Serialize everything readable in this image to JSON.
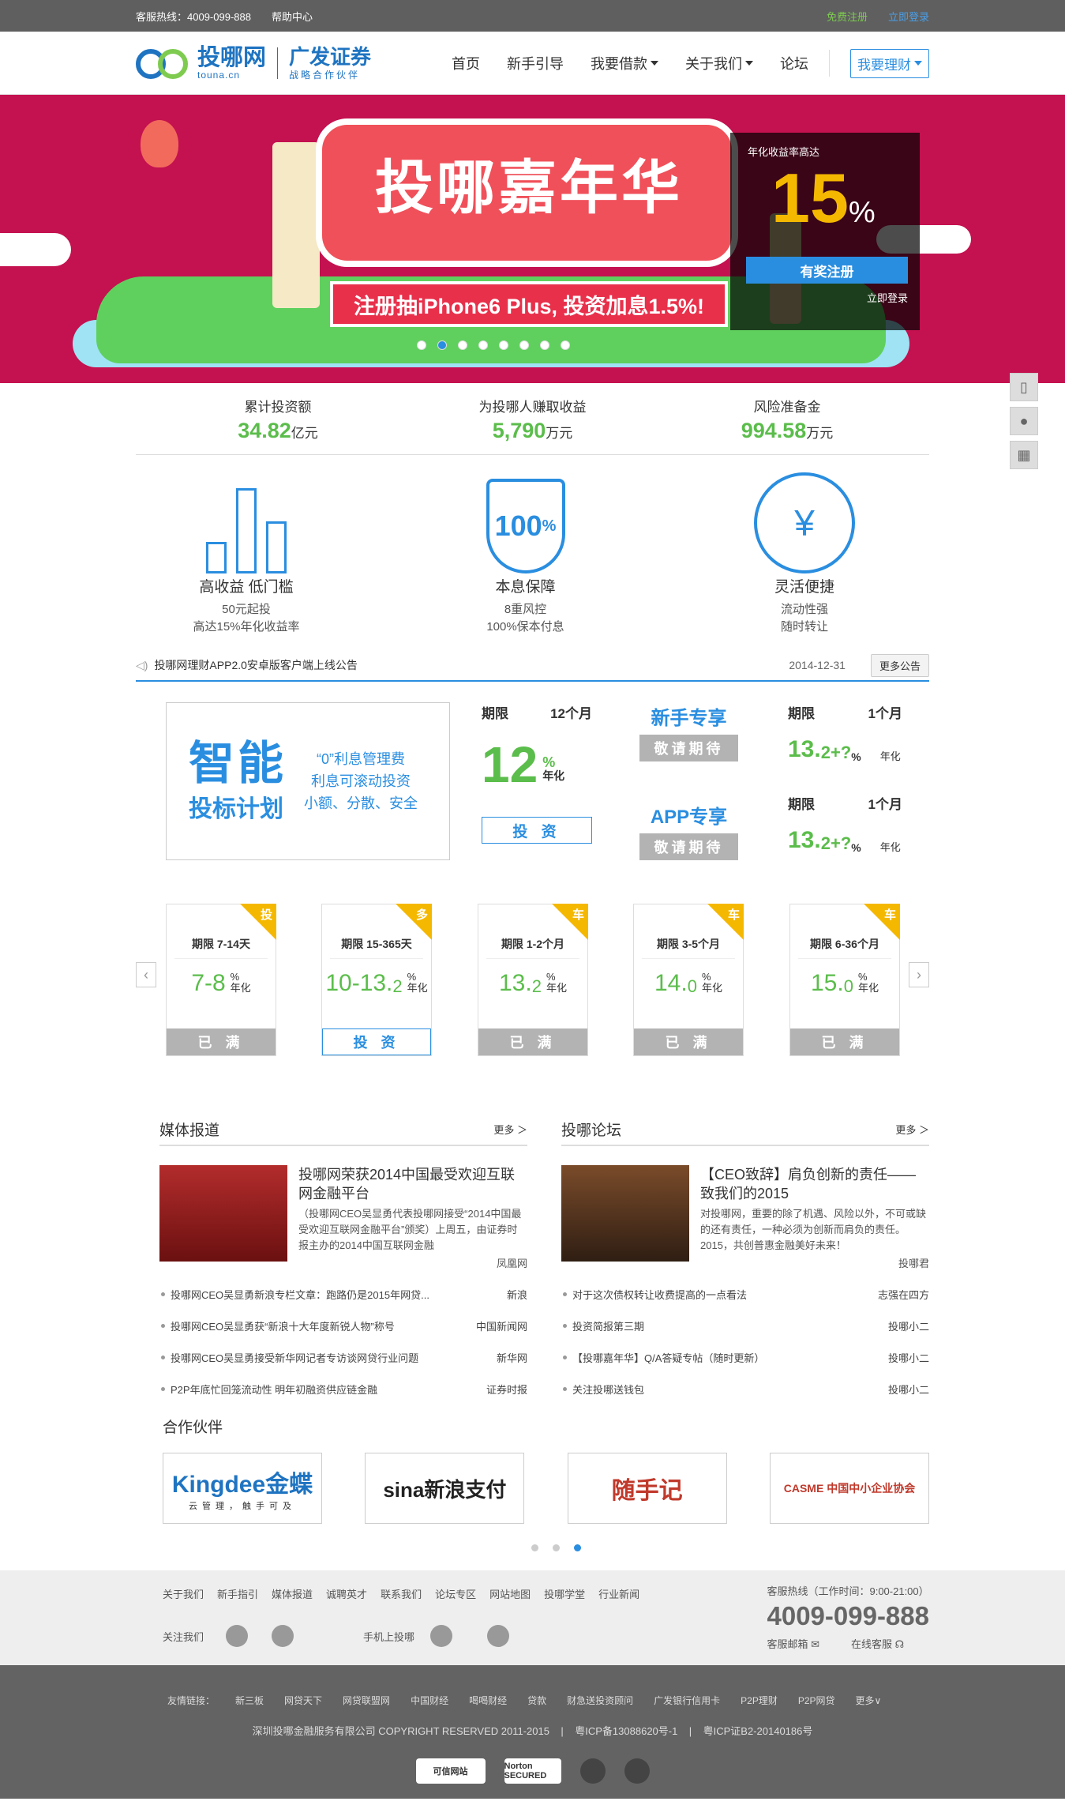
{
  "topbar": {
    "hotline": "客服热线：4009-099-888",
    "help": "帮助中心",
    "register": "免费注册",
    "login": "立即登录"
  },
  "logo": {
    "name": "投哪网",
    "domain": "touna.cn",
    "partner": "广发证券",
    "partner_sub": "战略合作伙伴"
  },
  "nav": {
    "home": "首页",
    "guide": "新手引导",
    "borrow": "我要借款",
    "about": "关于我们",
    "forum": "论坛",
    "invest": "我要理财"
  },
  "banner": {
    "title": "投哪嘉年华",
    "ribbon": "注册抽iPhone6 Plus, 投资加息1.5%!",
    "rate_label": "年化收益率高达",
    "rate": "15",
    "rate_unit": "%",
    "button": "有奖注册",
    "login": "立即登录",
    "active_slide": 1
  },
  "stats": [
    {
      "label": "累计投资额",
      "value": "34.82",
      "unit": "亿元"
    },
    {
      "label": "为投哪人赚取收益",
      "value": "5,790",
      "unit": "万元"
    },
    {
      "label": "风险准备金",
      "value": "994.58",
      "unit": "万元"
    }
  ],
  "features": [
    {
      "title": "高收益 低门槛",
      "line1": "50元起投",
      "line2": "高达15%年化收益率"
    },
    {
      "title": "本息保障",
      "line1": "8重风控",
      "line2": "100%保本付息",
      "badge": "100",
      "badge_unit": "%"
    },
    {
      "title": "灵活便捷",
      "line1": "流动性强",
      "line2": "随时转让",
      "symbol": "¥"
    }
  ],
  "notice": {
    "text": "投哪网理财APP2.0安卓版客户端上线公告",
    "date": "2014-12-31",
    "more": "更多公告"
  },
  "smart": {
    "big1": "智能",
    "big2": "投标计划",
    "r1": "“0”利息管理费",
    "r2": "利息可滚动投资",
    "r3": "小额、分散、安全"
  },
  "plan_main": {
    "term_label": "期限",
    "term": "12个月",
    "rate": "12",
    "unit": "%",
    "year": "年化",
    "button": "投 资"
  },
  "plan_new": {
    "title": "新手专享",
    "button": "敬请期待",
    "term_label": "期限",
    "term": "1个月",
    "rate": "13.",
    "rate_sm": "2+?",
    "unit": "%",
    "year": "年化"
  },
  "plan_app": {
    "title": "APP专享",
    "button": "敬请期待",
    "term_label": "期限",
    "term": "1个月",
    "rate": "13.",
    "rate_sm": "2+?",
    "unit": "%",
    "year": "年化"
  },
  "cards": [
    {
      "tag": "投",
      "term": "期限 7-14天",
      "rate": "7-8",
      "button": "已 满",
      "state": "full"
    },
    {
      "tag": "多",
      "term": "期限 15-365天",
      "rate": "10-13.",
      "rate_sm": "2",
      "button": "投 资",
      "state": "invest"
    },
    {
      "tag": "车",
      "term": "期限 1-2个月",
      "rate": "13.",
      "rate_sm": "2",
      "button": "已 满",
      "state": "full"
    },
    {
      "tag": "车",
      "term": "期限 3-5个月",
      "rate": "14.",
      "rate_sm": "0",
      "button": "已 满",
      "state": "full"
    },
    {
      "tag": "车",
      "term": "期限 6-36个月",
      "rate": "15.",
      "rate_sm": "0",
      "button": "已 满",
      "state": "full"
    }
  ],
  "card_unit": "%",
  "card_year": "年化",
  "media": {
    "title": "媒体报道",
    "more": "更多 ＞",
    "feat_title": "投哪网荣获2014中国最受欢迎互联网金融平台",
    "feat_desc": "（投哪网CEO吴显勇代表投哪网接受“2014中国最受欢迎互联网金融平台”颁奖）上周五，由证券时报主办的2014中国互联网金融",
    "feat_src": "凤凰网",
    "items": [
      {
        "t": "投哪网CEO吴显勇新浪专栏文章：跑路仍是2015年网贷...",
        "s": "新浪"
      },
      {
        "t": "投哪网CEO吴显勇获“新浪十大年度新锐人物”称号",
        "s": "中国新闻网"
      },
      {
        "t": "投哪网CEO吴显勇接受新华网记者专访谈网贷行业问题",
        "s": "新华网"
      },
      {
        "t": "P2P年底忙回笼流动性 明年初融资供应链金融",
        "s": "证券时报"
      }
    ]
  },
  "forum": {
    "title": "投哪论坛",
    "more": "更多 ＞",
    "feat_title": "【CEO致辞】肩负创新的责任——致我们的2015",
    "feat_desc": "对投哪网，重要的除了机遇、风险以外，不可或缺的还有责任，一种必须为创新而肩负的责任。2015，共创普惠金融美好未来！",
    "feat_src": "投哪君",
    "items": [
      {
        "t": "对于这次债权转让收费提高的一点看法",
        "s": "志强在四方"
      },
      {
        "t": "投资简报第三期",
        "s": "投哪小二"
      },
      {
        "t": "【投哪嘉年华】Q/A答疑专帖（随时更新）",
        "s": "投哪小二"
      },
      {
        "t": "关注投哪送钱包",
        "s": "投哪小二"
      }
    ]
  },
  "partners": {
    "title": "合作伙伴",
    "logos": [
      "Kingdee金蝶",
      "sina新浪支付",
      "随手记",
      "CASME 中国中小企业协会"
    ],
    "kingdee_sub": "云管理，触手可及",
    "active_dot": 2
  },
  "footer": {
    "links": [
      "关于我们",
      "新手指引",
      "媒体报道",
      "诚聘英才",
      "联系我们",
      "论坛专区",
      "网站地图",
      "投哪学堂",
      "行业新闻"
    ],
    "follow": "关注我们",
    "mobile": "手机上投哪",
    "hotline_label": "客服热线（工作时间：9:00-21:00）",
    "hotline": "4009-099-888",
    "mail": "客服邮箱",
    "online": "在线客服",
    "friend_label": "友情链接：",
    "friends": [
      "新三板",
      "网贷天下",
      "网贷联盟网",
      "中国财经",
      "喝喝财经",
      "贷款",
      "财急送投资顾问",
      "广发银行信用卡",
      "P2P理财",
      "P2P网贷",
      "更多∨"
    ],
    "copyright": "深圳投哪金融服务有限公司 COPYRIGHT RESERVED 2011-2015",
    "icp1": "粤ICP备13088620号-1",
    "icp2": "粤ICP证B2-20140186号",
    "badges": [
      "可信网站",
      "Norton SECURED"
    ]
  }
}
